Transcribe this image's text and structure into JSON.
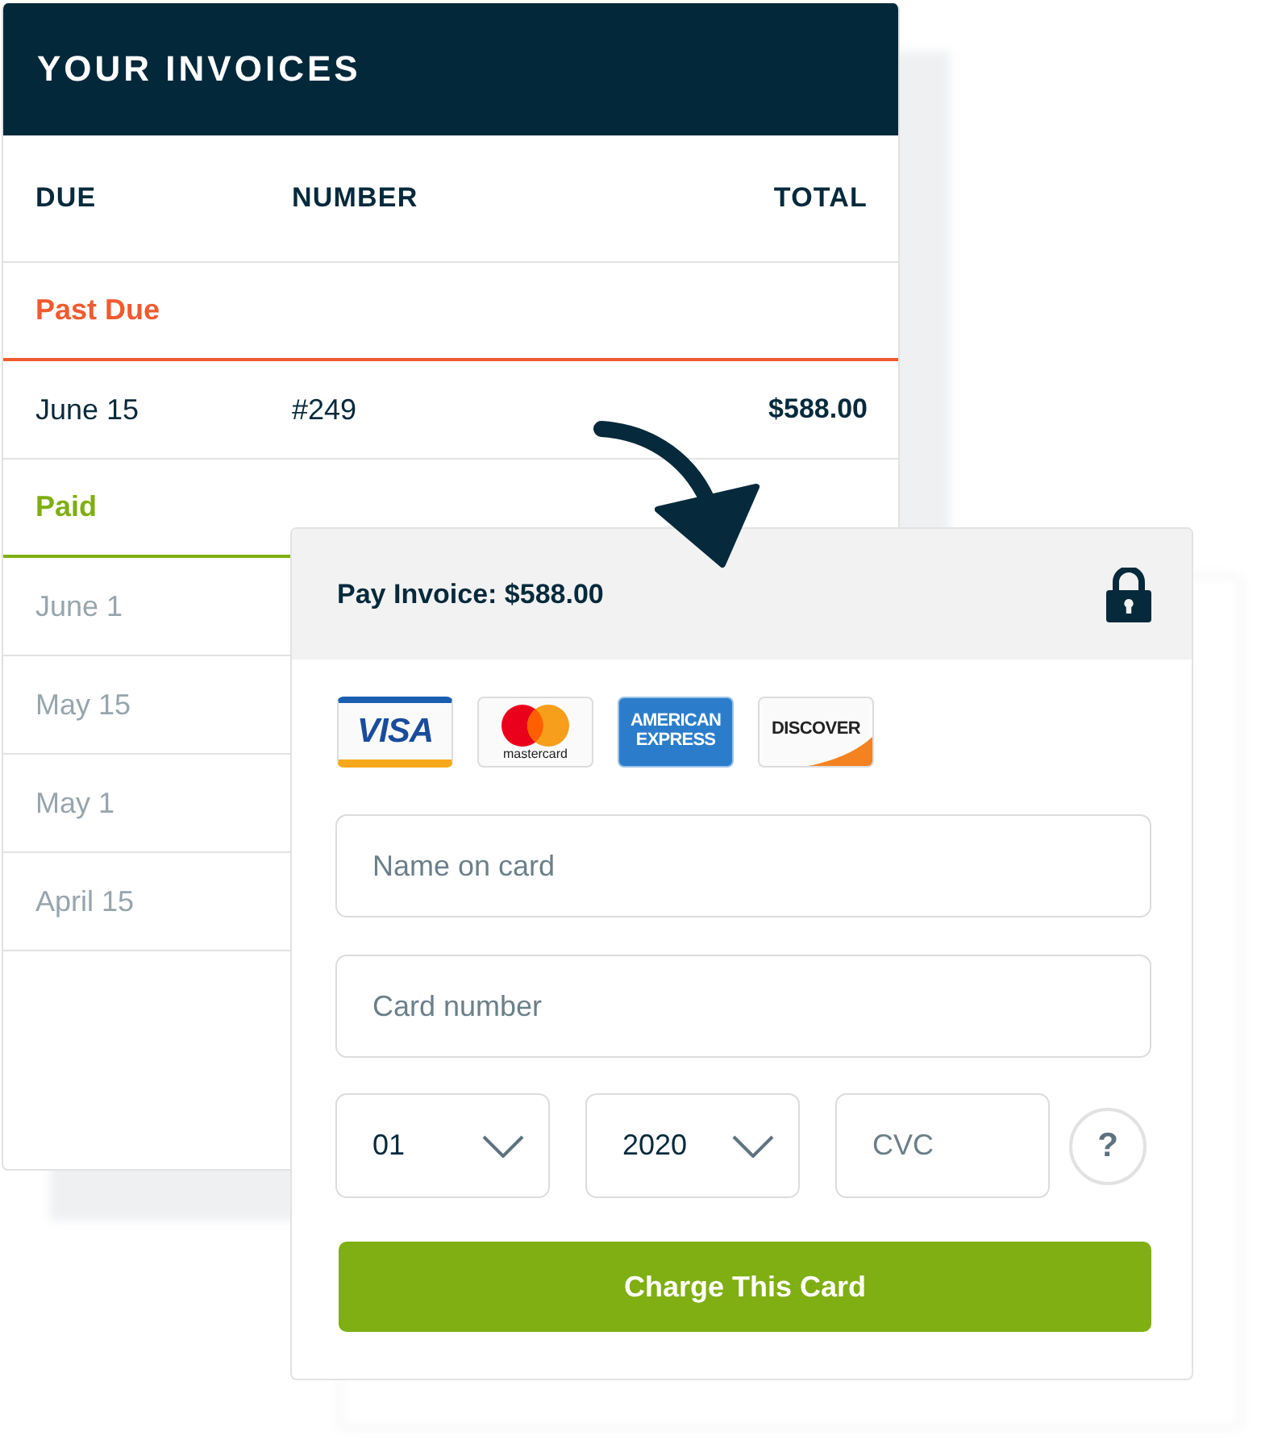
{
  "invoices": {
    "title": "YOUR INVOICES",
    "columns": [
      "DUE",
      "NUMBER",
      "TOTAL"
    ],
    "groups": [
      {
        "label": "Past Due",
        "kind": "past_due",
        "color": "#f15a30",
        "rows": [
          {
            "due": "June 15",
            "number": "#249",
            "total": "$588.00"
          }
        ]
      },
      {
        "label": "Paid",
        "kind": "paid",
        "color": "#7fae12",
        "rows": [
          {
            "due": "June 1"
          },
          {
            "due": "May 15"
          },
          {
            "due": "May 1"
          },
          {
            "due": "April 15"
          }
        ]
      }
    ]
  },
  "payment": {
    "title": "Pay Invoice: $588.00",
    "card_brands": [
      {
        "kind": "visa",
        "text": "VISA"
      },
      {
        "kind": "mastercard",
        "text": "mastercard"
      },
      {
        "kind": "amex",
        "text": "AMERICAN EXPRESS"
      },
      {
        "kind": "discover",
        "text": "DISCOVER"
      }
    ],
    "name_field": {
      "placeholder": "Name on card"
    },
    "number_field": {
      "placeholder": "Card number"
    },
    "month_select": {
      "value": "01"
    },
    "year_select": {
      "value": "2020"
    },
    "cvc_field": {
      "placeholder": "CVC"
    },
    "help_button": "?",
    "submit_button": "Charge This Card"
  }
}
